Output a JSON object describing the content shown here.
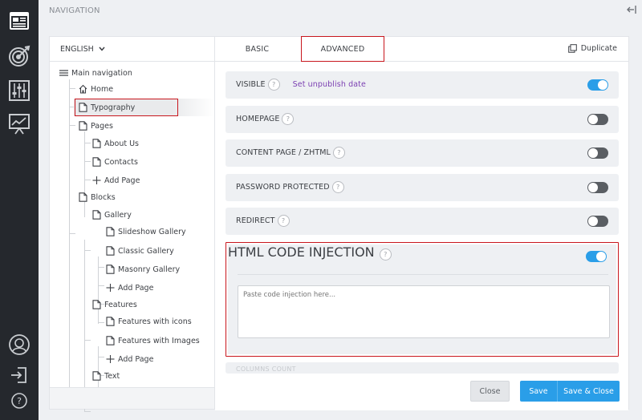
{
  "header": {
    "title": "NAVIGATION"
  },
  "rail": {
    "icons": [
      "layout-icon",
      "target-icon",
      "sliders-icon",
      "chart-board-icon",
      "user-face-icon",
      "sign-in-icon",
      "help-circle-icon"
    ]
  },
  "language": {
    "selected": "ENGLISH"
  },
  "tree": {
    "root": "Main navigation",
    "home": "Home",
    "typography": "Typography",
    "pages": "Pages",
    "about": "About Us",
    "contacts": "Contacts",
    "add_page": "Add Page",
    "blocks": "Blocks",
    "gallery": "Gallery",
    "slideshow": "Slideshow Gallery",
    "classic": "Classic Gallery",
    "masonry": "Masonry Gallery",
    "features": "Features",
    "features_icons": "Features with icons",
    "features_images": "Features with Images",
    "text": "Text"
  },
  "tabs": {
    "basic": "BASIC",
    "advanced": "ADVANCED",
    "duplicate": "Duplicate"
  },
  "settings": {
    "visible": {
      "label": "VISIBLE",
      "link": "Set unpublish date",
      "enabled": true
    },
    "homepage": {
      "label": "HOMEPAGE",
      "enabled": false
    },
    "content_page": {
      "label": "CONTENT PAGE / ZHTML",
      "enabled": false
    },
    "password": {
      "label": "PASSWORD PROTECTED",
      "enabled": false
    },
    "redirect": {
      "label": "REDIRECT",
      "enabled": false
    },
    "injection": {
      "label": "HTML CODE INJECTION",
      "enabled": true,
      "placeholder": "Paste code injection here..."
    },
    "faded_label": "COLUMNS COUNT",
    "help_glyph": "?"
  },
  "buttons": {
    "close": "Close",
    "save": "Save",
    "save_close": "Save & Close"
  },
  "colors": {
    "accent": "#2a9ee8",
    "highlight": "#c8161d",
    "link": "#7b3fb2",
    "rail": "#25282d"
  }
}
